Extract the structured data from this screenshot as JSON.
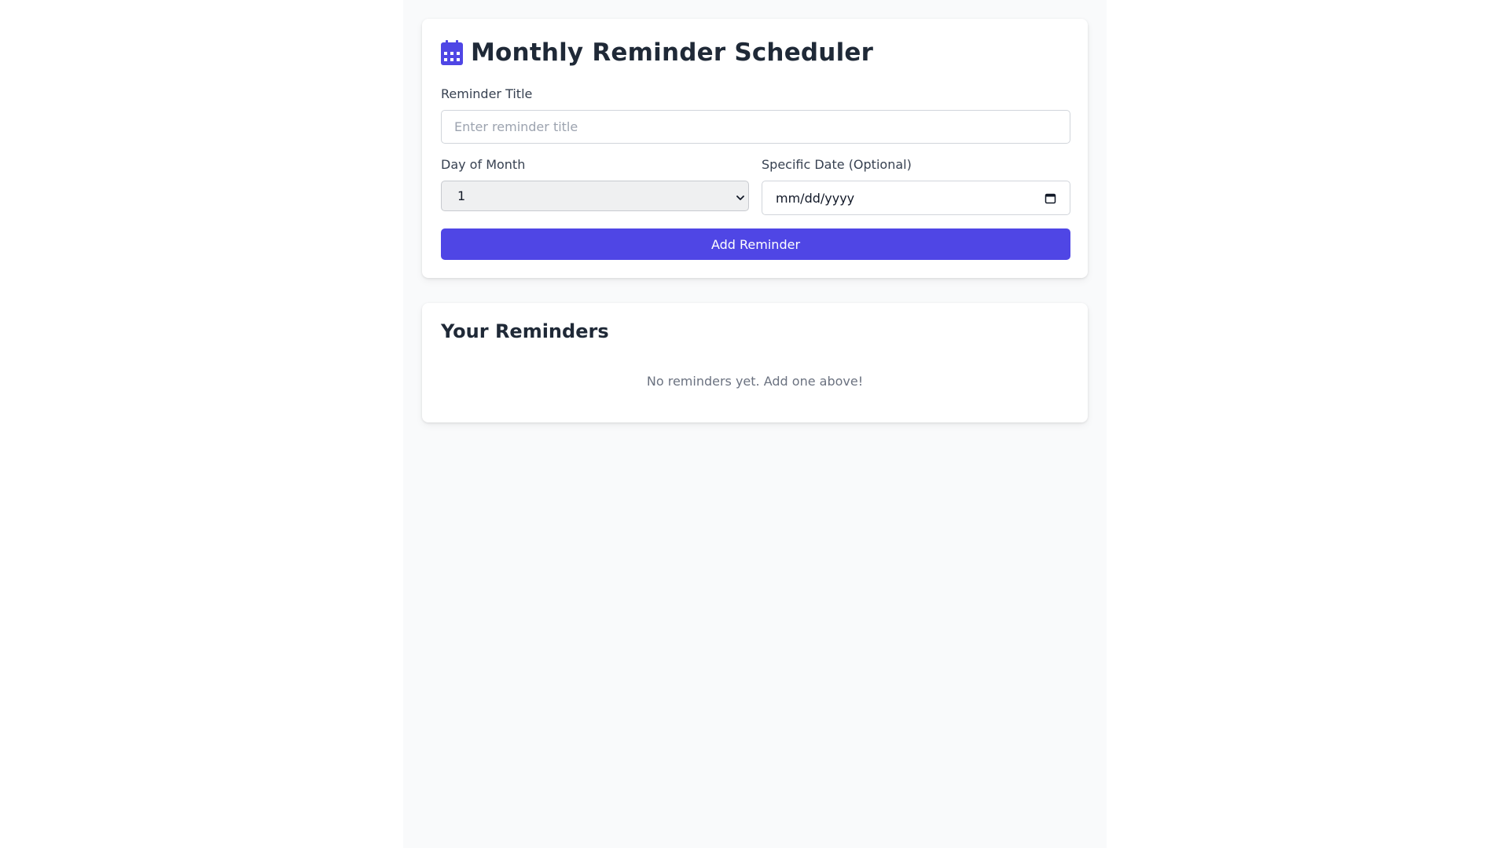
{
  "form": {
    "icon": "calendar-icon",
    "title": "Monthly Reminder Scheduler",
    "reminder_title_label": "Reminder Title",
    "reminder_title_placeholder": "Enter reminder title",
    "reminder_title_value": "",
    "day_of_month_label": "Day of Month",
    "day_of_month_value": "1",
    "specific_date_label": "Specific Date (Optional)",
    "specific_date_value": "mm/dd/yyyy",
    "add_button_label": "Add Reminder"
  },
  "reminders": {
    "title": "Your Reminders",
    "items": [],
    "empty_text": "No reminders yet. Add one above!"
  },
  "colors": {
    "accent": "#4f46e5",
    "page_background": "#f9fafb",
    "card_background": "#ffffff",
    "heading_text": "#1f2937",
    "muted_text": "#6b7280"
  }
}
